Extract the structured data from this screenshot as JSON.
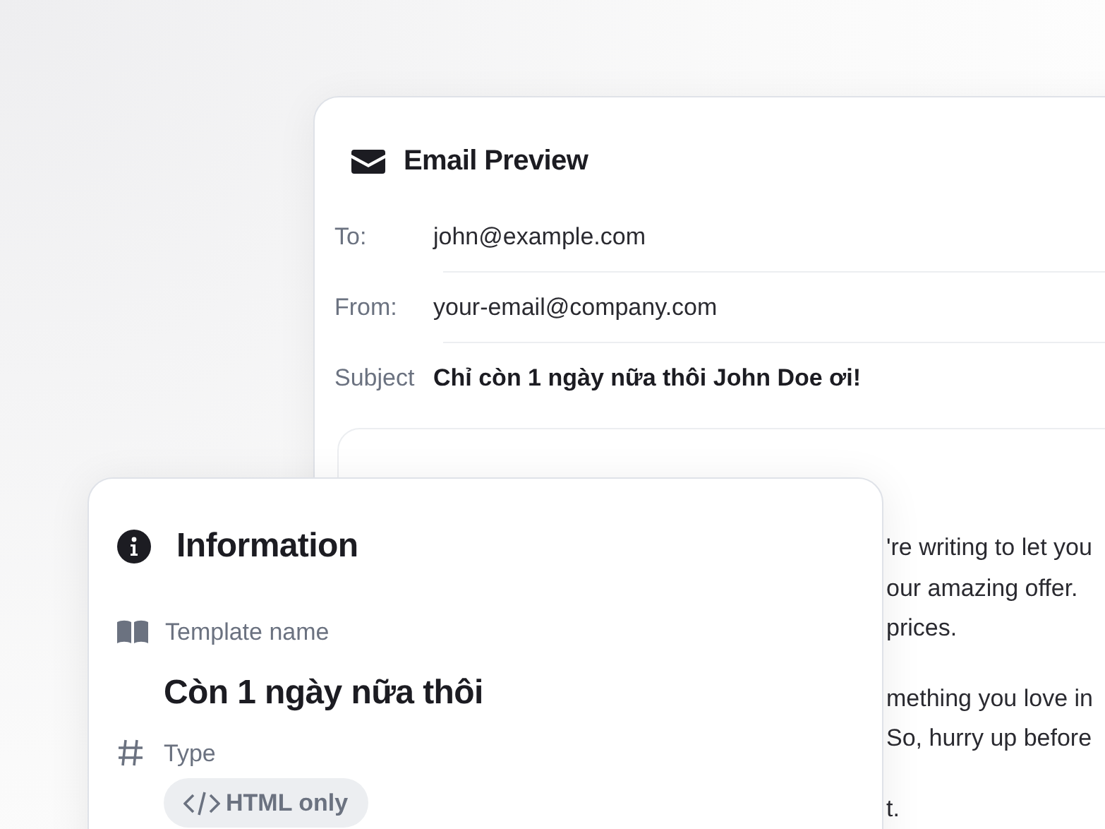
{
  "email_preview": {
    "title": "Email Preview",
    "fields": [
      {
        "label": "To:",
        "value": "john@example.com",
        "kind": "plain"
      },
      {
        "label": "From:",
        "value": "your-email@company.com",
        "kind": "plain"
      },
      {
        "label": "Subject",
        "value": "Chỉ còn 1 ngày nữa thôi John Doe ơi!",
        "kind": "bold"
      }
    ],
    "body": {
      "paragraphs": [
        {
          "lines": [
            "'re writing to let you",
            "our amazing offer.",
            "prices."
          ]
        },
        {
          "lines": [
            "mething you love in",
            "So, hurry up before"
          ]
        },
        {
          "lines": [
            "t."
          ]
        }
      ]
    }
  },
  "information": {
    "title": "Information",
    "template_name": {
      "label": "Template name",
      "value": "Còn 1 ngày nữa thôi"
    },
    "type": {
      "label": "Type",
      "badge": "HTML only"
    }
  }
}
